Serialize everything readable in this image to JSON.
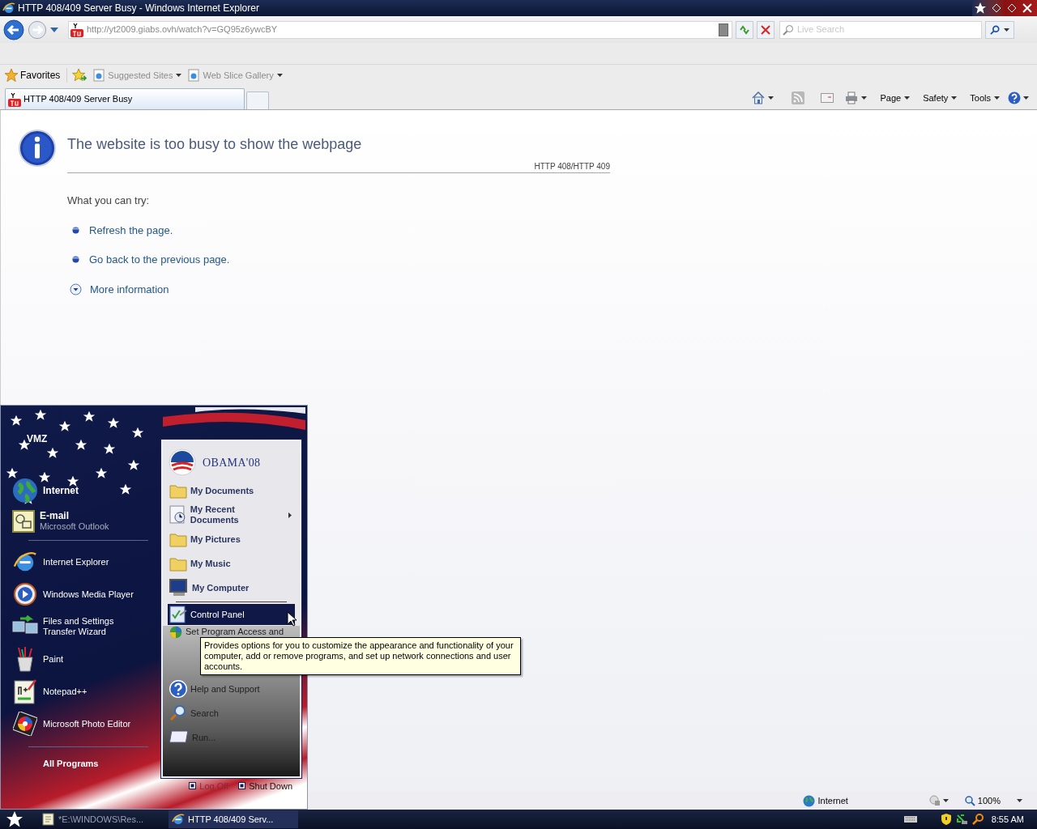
{
  "window": {
    "title": "HTTP 408/409 Server Busy - Windows Internet Explorer"
  },
  "navigation": {
    "address": "http://yt2009.giabs.ovh/watch?v=GQ95z6ywcBY",
    "search": {
      "placeholder": "Live Search"
    }
  },
  "favorites_bar": {
    "favorites": "Favorites",
    "links": [
      "Suggested Sites",
      "Web Slice Gallery"
    ]
  },
  "tabs": [
    {
      "label": "HTTP 408/409 Server Busy",
      "selected": true
    }
  ],
  "command_bar": [
    "Page",
    "Safety",
    "Tools"
  ],
  "error_page": {
    "heading": "The website is too busy to show the webpage",
    "code": "HTTP 408/HTTP 409",
    "prompt": "What you can try:",
    "suggestions": [
      "Refresh the page.",
      "Go back to the previous page."
    ],
    "more_info": "More information"
  },
  "status_bar": {
    "zone": "Internet",
    "zoom": "100%"
  },
  "start_menu": {
    "user": "VMZ",
    "pinned": [
      {
        "title": "Internet",
        "kind": "globe"
      },
      {
        "title": "E-mail",
        "subtitle": "Microsoft Outlook",
        "kind": "mail"
      }
    ],
    "recent": [
      {
        "label": "Internet Explorer",
        "kind": "ie"
      },
      {
        "label": "Windows Media Player",
        "kind": "media"
      },
      {
        "label": "Files and Settings Transfer Wizard",
        "kind": "wizard"
      },
      {
        "label": "Paint",
        "kind": "paint"
      },
      {
        "label": "Notepad++",
        "kind": "notepad"
      },
      {
        "label": "Microsoft Photo Editor",
        "kind": "photo"
      }
    ],
    "all_programs": "All Programs",
    "logo": "OBAMA'08",
    "places": [
      {
        "label": "My Documents",
        "kind": "user",
        "selected": false,
        "has_submenu": false
      },
      {
        "label": "My Recent Documents",
        "kind": "user",
        "selected": false,
        "has_submenu": true
      },
      {
        "label": "My Pictures",
        "kind": "user",
        "selected": false,
        "has_submenu": false
      },
      {
        "label": "My Music",
        "kind": "user",
        "selected": false,
        "has_submenu": false
      },
      {
        "label": "My Computer",
        "kind": "user",
        "selected": false,
        "has_submenu": false
      },
      {
        "label": "Control Panel",
        "kind": "system",
        "selected": true,
        "has_submenu": false
      },
      {
        "label": "Set Program Access and",
        "kind": "system",
        "selected": false,
        "has_submenu": false
      },
      {
        "label": "Help and Support",
        "kind": "system",
        "selected": false,
        "has_submenu": false
      },
      {
        "label": "Search",
        "kind": "system",
        "selected": false,
        "has_submenu": false
      },
      {
        "label": "Run...",
        "kind": "system",
        "selected": false,
        "has_submenu": false
      }
    ],
    "tooltip": "Provides options for you to customize the appearance and functionality of your computer, add or remove programs, and set up network connections and user accounts.",
    "log_off": "Log Off",
    "shut_down": "Shut Down"
  },
  "taskbar": {
    "buttons": [
      {
        "label": "*E:\\WINDOWS\\Res...",
        "selected": false
      },
      {
        "label": "HTTP 408/409 Serv...",
        "selected": true
      }
    ],
    "clock": "8:55 AM"
  }
}
